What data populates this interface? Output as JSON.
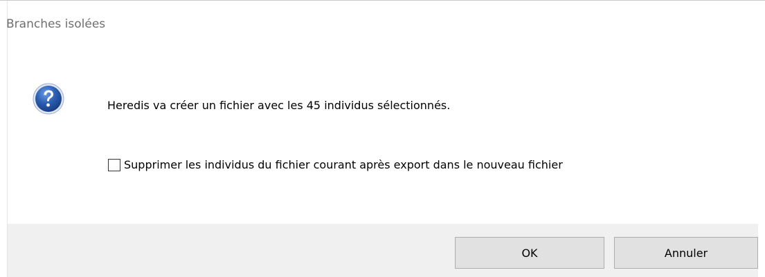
{
  "window": {
    "title": "Branches isolées"
  },
  "dialog": {
    "icon": "question-icon",
    "message": "Heredis va créer un fichier avec les 45 individus sélectionnés.",
    "checkbox": {
      "label": "Supprimer les individus du fichier courant après export dans le nouveau fichier",
      "checked": false
    }
  },
  "buttons": {
    "ok_label": "OK",
    "cancel_label": "Annuler"
  },
  "colors": {
    "icon_blue": "#2a5db0",
    "footer_bg": "#f0f0f0",
    "button_bg": "#e1e1e1"
  }
}
